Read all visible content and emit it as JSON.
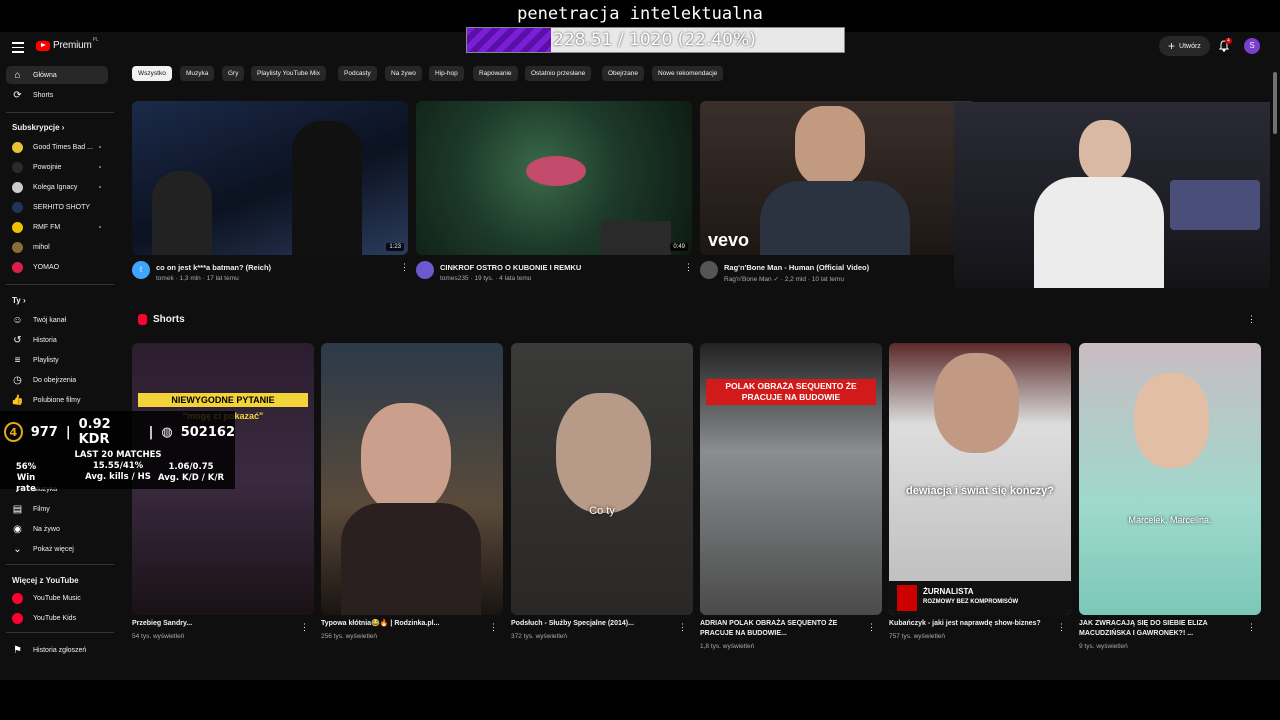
{
  "overlay": {
    "title": "penetracja intelektualna",
    "progress_text": "228.51 / 1020 (22.40%)",
    "progress_fraction": 0.224
  },
  "header": {
    "logo_text": "Premium",
    "logo_region": "PL",
    "create_label": "Utwórz",
    "notif_count": "4",
    "avatar_letter": "S"
  },
  "sidebar": {
    "home": "Główna",
    "shorts": "Shorts",
    "subs_heading": "Subskrypcje",
    "subs": [
      "Good Times Bad ...",
      "Powojnie",
      "Kolega Ignacy",
      "SERHITO SHOTY",
      "RMF FM",
      "mihol",
      "YOMAO"
    ],
    "you_heading": "Ty",
    "you": [
      "Twój kanał",
      "Historia",
      "Playlisty",
      "Do obejrzenia",
      "Polubione filmy"
    ],
    "explore": [
      "Muzyka",
      "Filmy",
      "Na żywo",
      "Pokaż więcej"
    ],
    "more_heading": "Więcej z YouTube",
    "more": [
      "YouTube Music",
      "YouTube Kids"
    ],
    "report": "Historia zgłoszeń"
  },
  "chips": [
    "Wszystko",
    "Muzyka",
    "Gry",
    "Playlisty YouTube Mix",
    "Podcasty",
    "Na żywo",
    "Hip-hop",
    "Rapowanie",
    "Ostatnio przesłane",
    "Obejrzane",
    "Nowe rekomendacje"
  ],
  "videos": [
    {
      "title": "co on jest k***a batman? (Reich)",
      "channel": "tomek",
      "meta": "1,3 mln · 17 lat temu",
      "duration": "1:23",
      "avatar_letter": "t"
    },
    {
      "title": "CINKROF OSTRO O KUBONIE I REMKU",
      "channel": "tomes235",
      "meta": "19 tys. · 4 lata temu",
      "duration": "0:49"
    },
    {
      "title": "Rag'n'Bone Man - Human (Official Video)",
      "channel": "Rag'n'Bone Man ✓",
      "meta": "2,2 mld · 10 lat temu",
      "thumb_label": "vevo"
    }
  ],
  "shorts_heading": "Shorts",
  "shorts": [
    {
      "title": "Przebieg Sandry...",
      "meta": "54 tys. wyświetleń",
      "band": "NIEWYGODNE PYTANIE",
      "band2": "\"mogę ci pokazać\""
    },
    {
      "title": "Typowa kłótnia😂🔥 | Rodzinka.pl...",
      "meta": "256 tys. wyświetleń"
    },
    {
      "title": "Podsłuch - Służby Specjalne (2014)...",
      "meta": "372 tys. wyświetleń",
      "caption": "Co ty"
    },
    {
      "title": "ADRIAN POLAK OBRAŻA SEQUENTO ŻE PRACUJE NA BUDOWIE...",
      "meta": "1,8 tys. wyświetleń",
      "band": "POLAK OBRAŻA SEQUENTO ŻE PRACUJE NA BUDOWIE"
    },
    {
      "title": "Kubańczyk - jaki jest naprawdę show-biznes?",
      "meta": "757 tys. wyświetleń",
      "caption": "dewiacja i świat się kończy?",
      "brand": "ŻURNALISTA",
      "brand_sub": "ROZMOWY BEZ KOMPROMISÓW"
    },
    {
      "title": "JAK ZWRACAJĄ SIĘ DO SIEBIE ELIZA MACUDZIŃSKA I GAWRONEK?! ...",
      "meta": "9 tys. wyświetleń",
      "caption": "Marcelek, Marcelina."
    }
  ],
  "game_stats": {
    "level": "4",
    "elo": "977",
    "kdr": "0.92 KDR",
    "points": "502162",
    "win_rate_value": "56%",
    "win_rate_label": "Win rate",
    "last_matches": "LAST 20 MATCHES",
    "kills_value": "15.55/41%",
    "kills_label": "Avg. kills / HS",
    "kd_value": "1.06/0.75",
    "kd_label": "Avg. K/D / K/R"
  }
}
